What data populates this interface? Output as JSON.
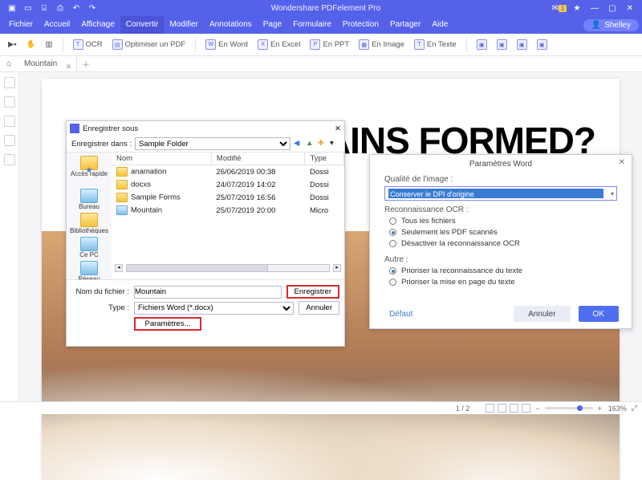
{
  "app": {
    "title": "Wondershare PDFelement Pro"
  },
  "titlebar_icons": {
    "new": "new",
    "open": "open",
    "print": "print",
    "undo": "undo",
    "redo": "redo",
    "mail": "mail",
    "star": "star",
    "min": "min",
    "max": "max",
    "close": "close"
  },
  "menu": {
    "items": [
      "Fichier",
      "Accueil",
      "Affichage",
      "Convertir",
      "Modifier",
      "Annotations",
      "Page",
      "Formulaire",
      "Protection",
      "Partager",
      "Aide"
    ],
    "active_index": 3,
    "user": "Shelley"
  },
  "toolbar": {
    "ocr": "OCR",
    "optimize": "Optimiser un PDF",
    "en_word": "En Word",
    "en_excel": "En Excel",
    "en_ppt": "En PPT",
    "en_image": "En Image",
    "en_texte": "En Texte"
  },
  "tab": {
    "name": "Mountain"
  },
  "document": {
    "headline_fragment": "TAINS FORMED?"
  },
  "status": {
    "page": "1 / 2",
    "zoom": "163%"
  },
  "save_dialog": {
    "title": "Enregistrer sous",
    "save_in_label": "Enregistrer dans :",
    "save_in_value": "Sample Folder",
    "columns": [
      "Nom",
      "Modifié",
      "Type"
    ],
    "rows": [
      {
        "name": "anamation",
        "modified": "26/06/2019 00:38",
        "type": "Dossi",
        "kind": "folder"
      },
      {
        "name": "docxs",
        "modified": "24/07/2019 14:02",
        "type": "Dossi",
        "kind": "folder"
      },
      {
        "name": "Sample Forms",
        "modified": "25/07/2019 16:56",
        "type": "Dossi",
        "kind": "folder"
      },
      {
        "name": "Mountain",
        "modified": "25/07/2019 20:00",
        "type": "Micro",
        "kind": "file"
      }
    ],
    "places": [
      "Accès rapide",
      "Bureau",
      "Bibliothèques",
      "Ce PC",
      "Réseau"
    ],
    "filename_label": "Nom du fichier :",
    "filename_value": "Mountain",
    "type_label": "Type :",
    "type_value": "Fichiers Word (*.docx)",
    "save_btn": "Enregistrer",
    "cancel_btn": "Annuler",
    "params_btn": "Paramètres..."
  },
  "param_dialog": {
    "title": "Paramètres Word",
    "quality_label": "Qualité de l'image :",
    "quality_value": "Conserver le DPI d'origine",
    "ocr_label": "Reconnaissance OCR :",
    "ocr_options": [
      "Tous les fichiers",
      "Seulement les PDF scannés",
      "Désactiver la reconnaissance OCR"
    ],
    "ocr_selected_index": 1,
    "other_label": "Autre :",
    "other_options": [
      "Prioriser la reconnaissance du texte",
      "Prioriser la mise en page du texte"
    ],
    "other_selected_index": 0,
    "default_link": "Défaut",
    "cancel": "Annuler",
    "ok": "OK"
  }
}
